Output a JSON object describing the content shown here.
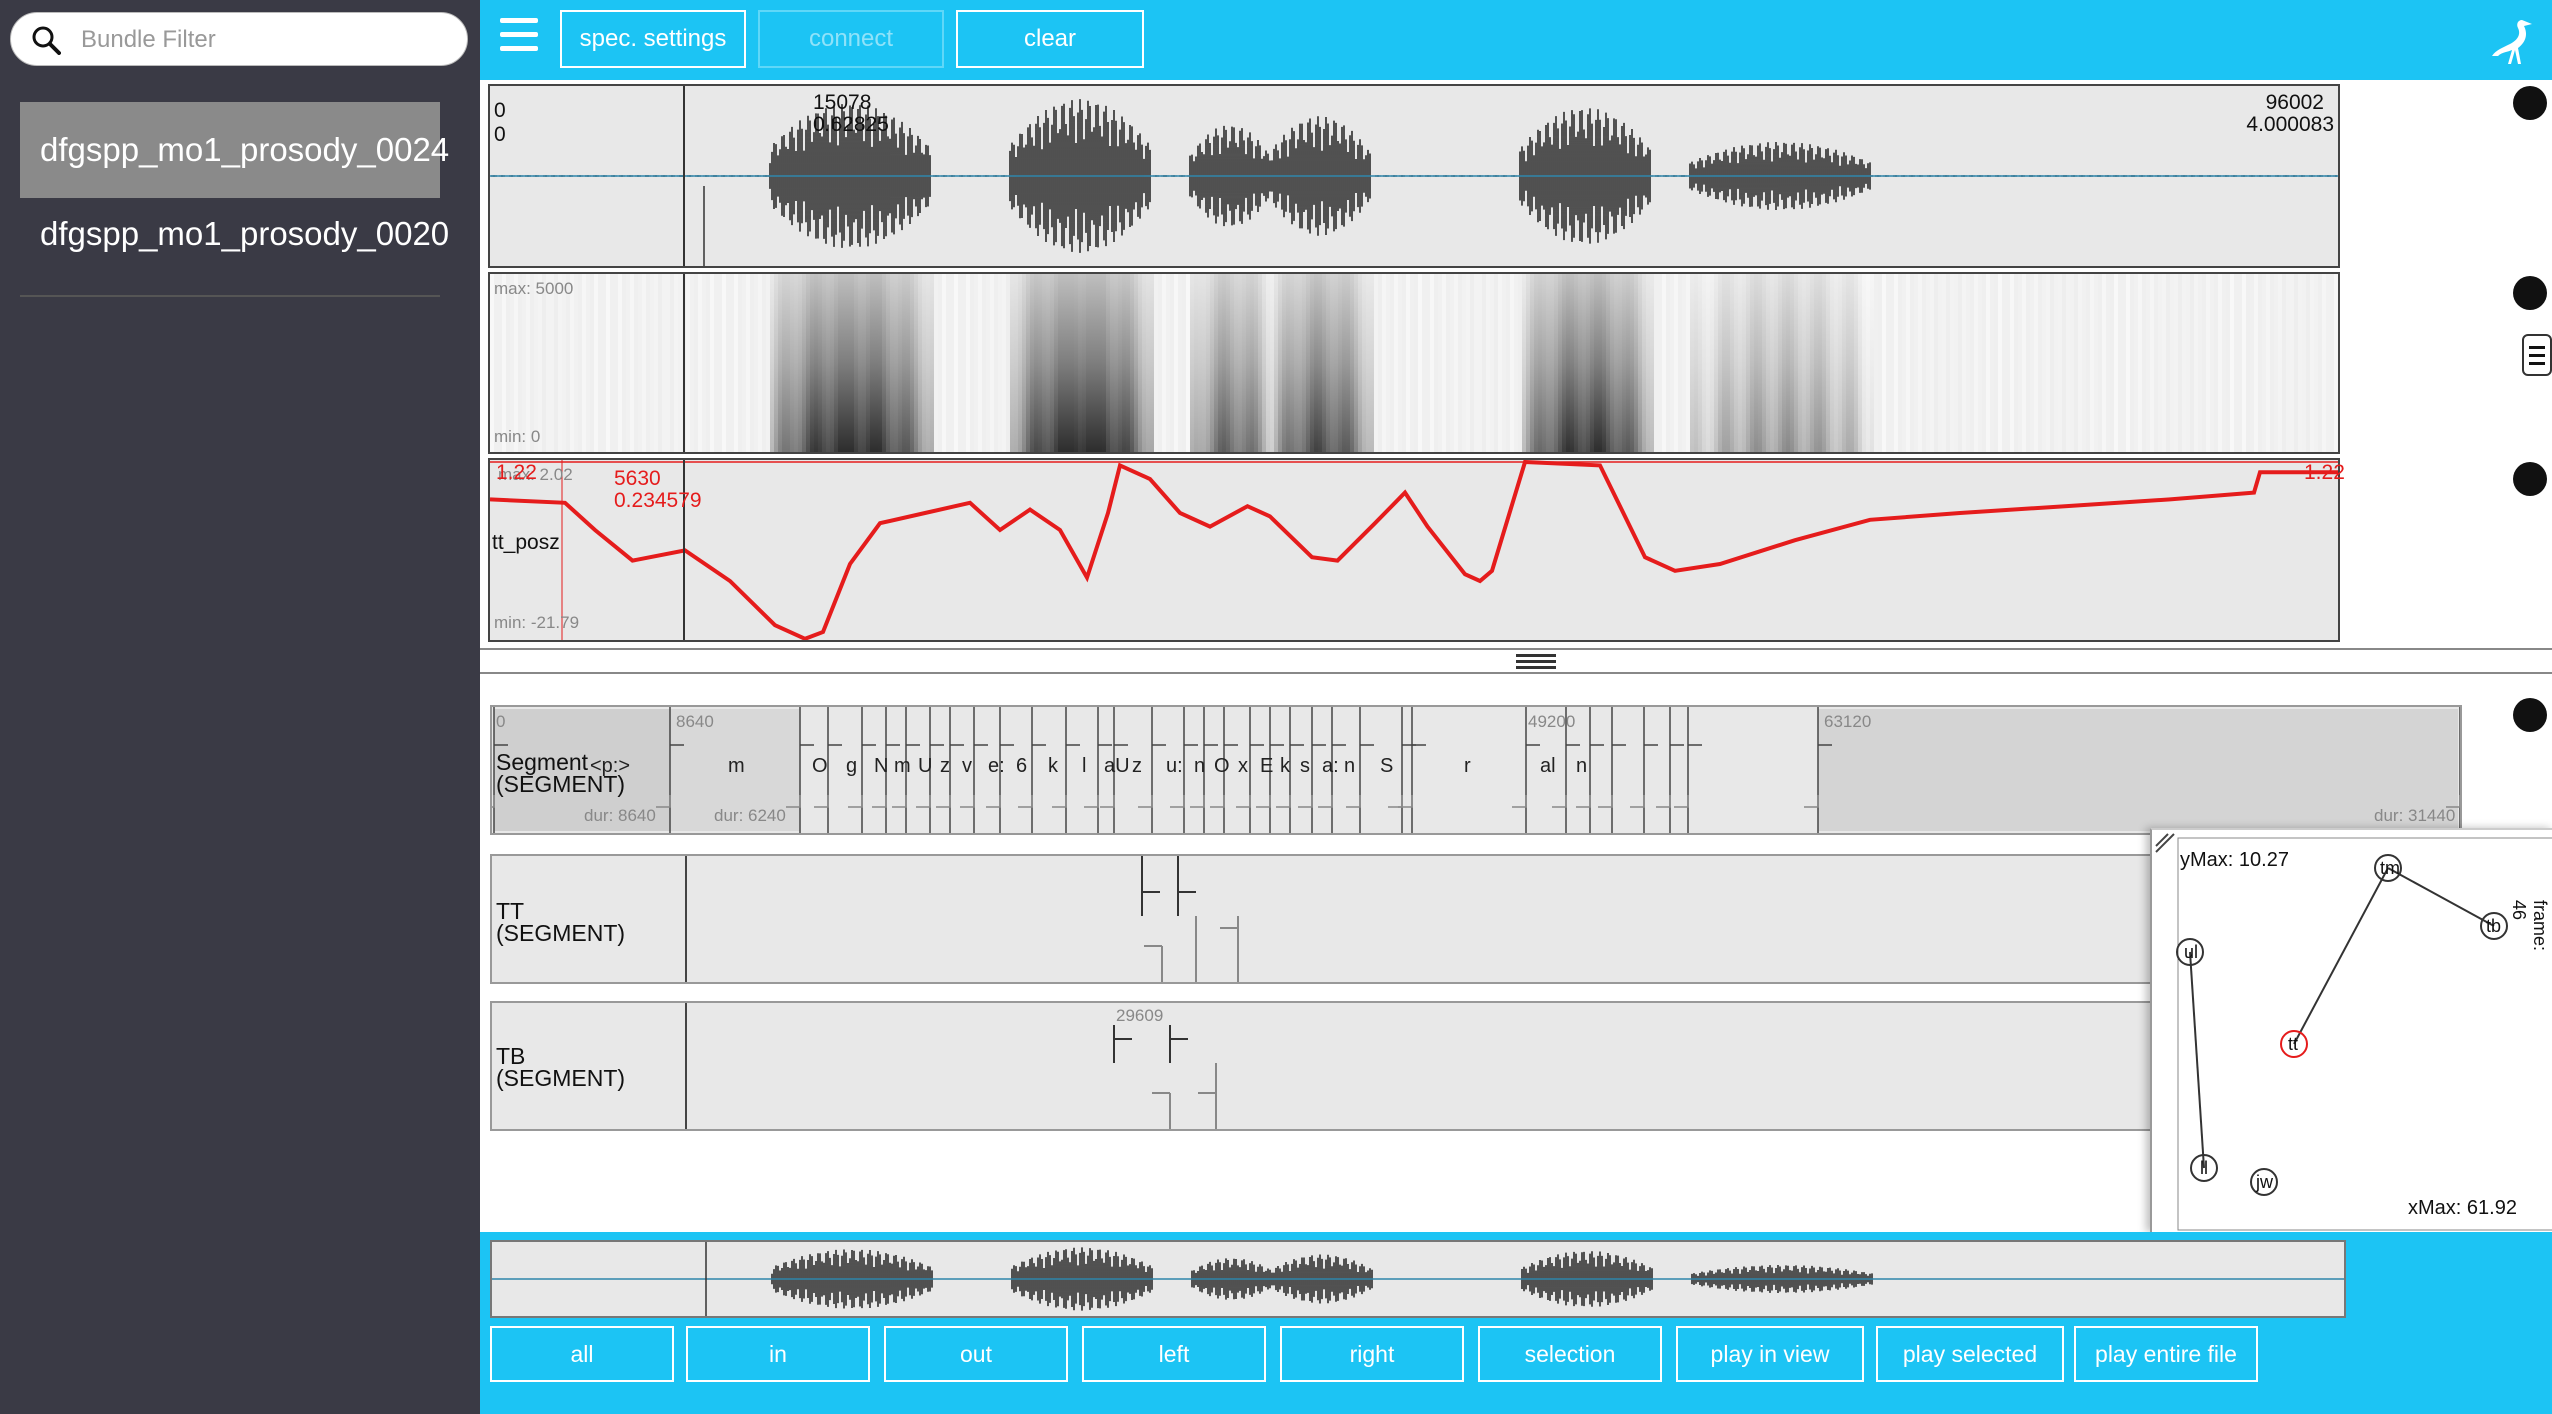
{
  "sidebar": {
    "filter_placeholder": "Bundle Filter",
    "bundles": [
      "dfgspp_mo1_prosody_0024",
      "dfgspp_mo1_prosody_0020"
    ]
  },
  "toolbar": {
    "spec_settings": "spec. settings",
    "connect": "connect",
    "clear": "clear"
  },
  "wave": {
    "min0": "0",
    "min1": "0",
    "sel_start_sample": "15078",
    "sel_start_time": "0.62825",
    "end_sample": "96002",
    "end_time": "4.000083"
  },
  "spec": {
    "max": "max: 5000",
    "min": "min: 0"
  },
  "ema": {
    "track": "tt_posz",
    "left_val": "1.22",
    "max_label": "max: 2.02",
    "min_label": "min: -21.79",
    "cursor_sample": "5630",
    "cursor_time": "0.234579",
    "right_val": "1.22"
  },
  "tiers": {
    "segment": {
      "name": "Segment",
      "type": "(SEGMENT)",
      "start": "0",
      "mark1": "8640",
      "mark2": "49200",
      "mark3": "63120",
      "dur1": "dur: 8640",
      "dur2": "dur: 6240",
      "dur_end": "dur: 31440",
      "labels": [
        "<p:>",
        "m",
        "O",
        "g",
        "N",
        "m",
        "U",
        "z",
        "v",
        "e:",
        "6",
        "k",
        "l",
        "aU",
        "z",
        "u:",
        "n",
        "O",
        "x",
        "E",
        "k",
        "s",
        "a:",
        "n",
        "S",
        "r",
        "al",
        "n"
      ]
    },
    "tt": {
      "name": "TT",
      "type": "(SEGMENT)"
    },
    "tb": {
      "name": "TB",
      "type": "(SEGMENT)",
      "mark": "29609"
    }
  },
  "ema2d": {
    "ymax": "yMax: 10.27",
    "xmax": "xMax: 61.92",
    "frame": "frame: 46",
    "points": [
      "tm",
      "tb",
      "ul",
      "tt",
      "ll",
      "jw"
    ]
  },
  "bottom": {
    "buttons": [
      "all",
      "in",
      "out",
      "left",
      "right",
      "selection",
      "play in view",
      "play selected",
      "play entire file"
    ]
  },
  "colors": {
    "accent": "#1cc4f4",
    "sidebar": "#3a3a45",
    "track": "#e51c1c"
  }
}
